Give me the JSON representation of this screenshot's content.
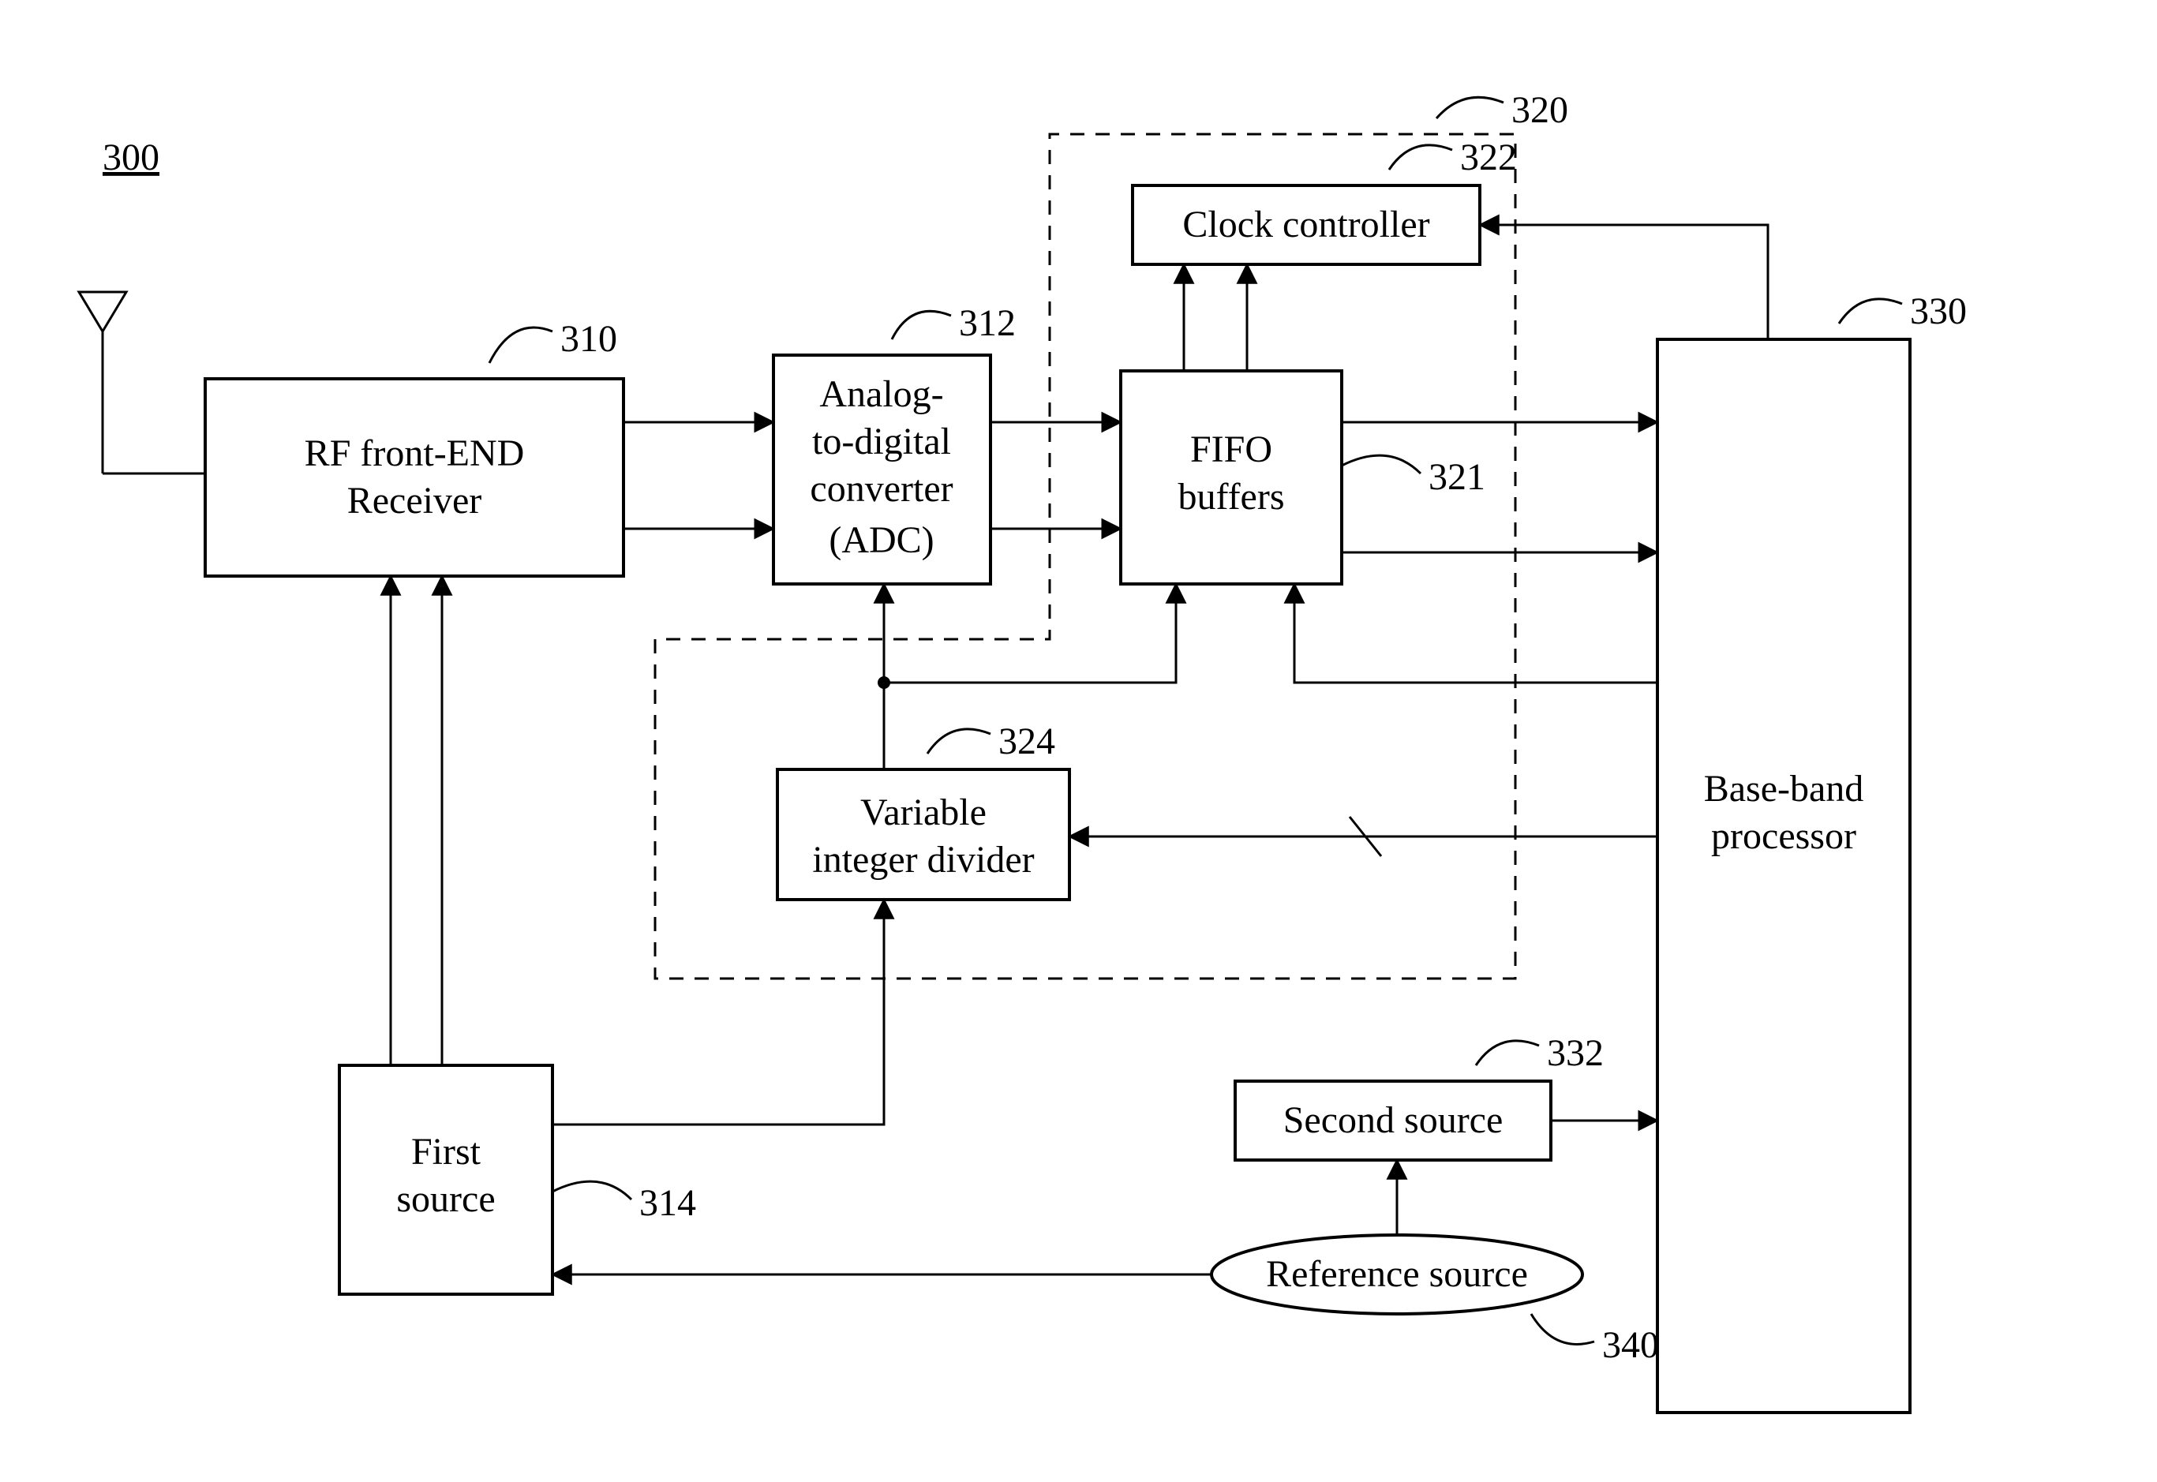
{
  "figure_ref": "300",
  "refs": {
    "rf_receiver": "310",
    "adc": "312",
    "first_source": "314",
    "group": "320",
    "fifo": "321",
    "clock_ctrl": "322",
    "divider": "324",
    "baseband": "330",
    "second_source": "332",
    "ref_source": "340"
  },
  "labels": {
    "rf_receiver_l1": "RF front-END",
    "rf_receiver_l2": "Receiver",
    "adc_l1": "Analog-",
    "adc_l2": "to-digital",
    "adc_l3": "converter",
    "adc_l4": "(ADC)",
    "fifo_l1": "FIFO",
    "fifo_l2": "buffers",
    "clock_ctrl": "Clock controller",
    "divider_l1": "Variable",
    "divider_l2": "integer divider",
    "first_source_l1": "First",
    "first_source_l2": "source",
    "second_source": "Second source",
    "ref_source": "Reference source",
    "baseband_l1": "Base-band",
    "baseband_l2": "processor"
  }
}
